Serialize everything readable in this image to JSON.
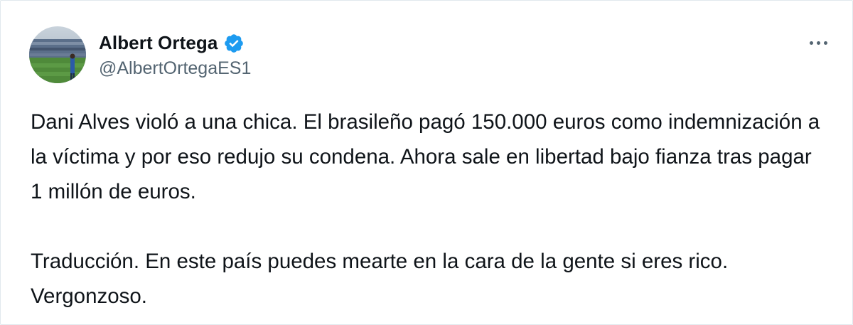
{
  "tweet": {
    "author": {
      "display_name": "Albert Ortega",
      "handle": "@AlbertOrtegaES1",
      "verified": true,
      "avatar_icon": "stadium-photo-avatar",
      "verified_icon": "verified-badge-icon"
    },
    "more_icon": "more-horizontal-icon",
    "paragraphs": [
      "Dani Alves violó a una chica. El brasileño pagó 150.000 euros como indemnización a la víctima y por eso redujo su condena. Ahora sale en libertad bajo fianza tras pagar 1 millón de euros.",
      "Traducción. En este país puedes mearte en la cara de la gente si eres rico. Vergonzoso."
    ]
  },
  "colors": {
    "text_primary": "#0f1419",
    "text_secondary": "#536471",
    "verified_blue": "#1d9bf0",
    "border": "#e1e8ed"
  }
}
